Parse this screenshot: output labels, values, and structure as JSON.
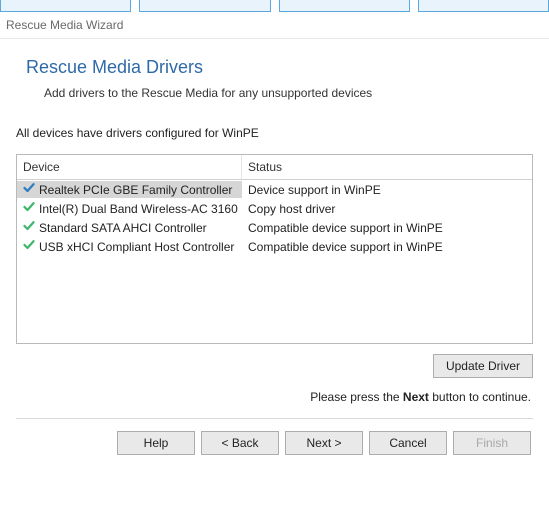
{
  "window_title": "Rescue Media Wizard",
  "header": {
    "title": "Rescue Media Drivers",
    "subtitle": "Add drivers to the Rescue Media for any unsupported devices"
  },
  "status_line": "All devices have drivers configured for WinPE",
  "table": {
    "columns": {
      "device": "Device",
      "status": "Status"
    },
    "rows": [
      {
        "icon": "check-blue",
        "device": "Realtek PCIe GBE Family Controller",
        "status": "Device support in WinPE",
        "selected": true
      },
      {
        "icon": "check-green",
        "device": "Intel(R) Dual Band Wireless-AC 3160",
        "status": "Copy host driver",
        "selected": false
      },
      {
        "icon": "check-green",
        "device": "Standard SATA AHCI Controller",
        "status": "Compatible device support in WinPE",
        "selected": false
      },
      {
        "icon": "check-green",
        "device": "USB xHCI Compliant Host Controller",
        "status": "Compatible device support in WinPE",
        "selected": false
      }
    ]
  },
  "buttons": {
    "update_driver": "Update Driver",
    "help": "Help",
    "back": "< Back",
    "next": "Next >",
    "cancel": "Cancel",
    "finish": "Finish"
  },
  "hint": {
    "pre": "Please press the ",
    "bold": "Next",
    "post": "  button to continue."
  },
  "colors": {
    "check_blue": "#2d7cc1",
    "check_green": "#3fb76a"
  }
}
